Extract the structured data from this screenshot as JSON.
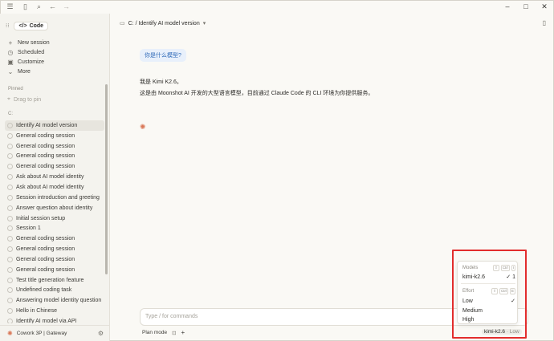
{
  "topbar": {
    "icons": [
      "menu-icon",
      "sidebar-icon",
      "search-icon",
      "back-icon",
      "forward-icon"
    ]
  },
  "sidebar": {
    "mode_label": "Code",
    "nav": [
      {
        "label": "New session",
        "icon": "plus-icon"
      },
      {
        "label": "Scheduled",
        "icon": "clock-icon"
      },
      {
        "label": "Customize",
        "icon": "briefcase-icon"
      },
      {
        "label": "More",
        "icon": "chevron-down-icon"
      }
    ],
    "pinned_label": "Pinned",
    "drag_to_pin": "Drag to pin",
    "group_label": "C:",
    "sessions": [
      "Identify AI model version",
      "General coding session",
      "General coding session",
      "General coding session",
      "General coding session",
      "Ask about AI model identity",
      "Ask about AI model identity",
      "Session introduction and greeting",
      "Answer question about identity",
      "Initial session setup",
      "Session 1",
      "General coding session",
      "General coding session",
      "General coding session",
      "General coding session",
      "Test title generation feature",
      "Undefined coding task",
      "Answering model identity question",
      "Hello in Chinese",
      "Identify AI model via API"
    ],
    "footer": "Cowork 3P | Gateway"
  },
  "main": {
    "breadcrumb": "C: / Identify AI model version",
    "user_message": "你是什么模型?",
    "reply_line1": "我是 Kimi K2.6。",
    "reply_line2": "这是由 Moonshot AI 开发的大型语言模型，目前通过 Claude Code 的 CLI 环境为你提供服务。",
    "composer_placeholder": "Type / for commands",
    "plan_mode": "Plan mode",
    "model_chip": "kimi-k2.6",
    "model_chip_effort": "· Low"
  },
  "popup": {
    "models_label": "Models",
    "models_keys": [
      "⇧",
      "Ctrl",
      "I"
    ],
    "model_name": "kimi-k2.6",
    "model_index": "1",
    "effort_label": "Effort",
    "effort_keys": [
      "⇧",
      "Ctrl",
      "E"
    ],
    "efforts": [
      "Low",
      "Medium",
      "High"
    ]
  },
  "colors": {
    "accent": "#d97757",
    "highlight": "#e22d2d",
    "bubble": "#e8f0fb"
  }
}
